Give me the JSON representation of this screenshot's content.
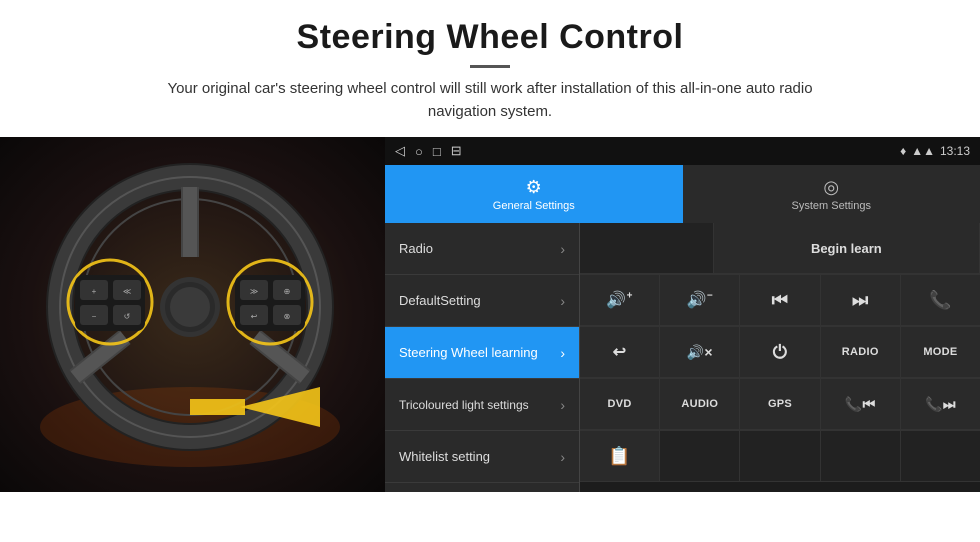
{
  "header": {
    "title": "Steering Wheel Control",
    "subtitle": "Your original car's steering wheel control will still work after installation of this all-in-one auto radio navigation system."
  },
  "status_bar": {
    "back": "◁",
    "home": "○",
    "recent": "□",
    "extra": "⊟",
    "signal": "▾▾",
    "wifi": "▲",
    "time": "13:13"
  },
  "tabs": [
    {
      "id": "general",
      "icon": "⚙",
      "label": "General Settings",
      "active": true
    },
    {
      "id": "system",
      "icon": "◎",
      "label": "System Settings",
      "active": false
    }
  ],
  "menu_items": [
    {
      "label": "Radio",
      "active": false
    },
    {
      "label": "DefaultSetting",
      "active": false
    },
    {
      "label": "Steering Wheel learning",
      "active": true
    },
    {
      "label": "Tricoloured light settings",
      "active": false
    },
    {
      "label": "Whitelist setting",
      "active": false
    }
  ],
  "control_panel": {
    "begin_learn_label": "Begin learn",
    "row1": [
      {
        "label": "",
        "empty": true
      },
      {
        "label": "Begin learn",
        "empty": false
      }
    ],
    "row2": [
      {
        "label": "🔊+",
        "icon": true
      },
      {
        "label": "🔊−",
        "icon": true
      },
      {
        "label": "⏮",
        "icon": true
      },
      {
        "label": "⏭",
        "icon": true
      },
      {
        "label": "📞",
        "icon": true
      }
    ],
    "row3": [
      {
        "label": "↩",
        "icon": true
      },
      {
        "label": "🔊×",
        "icon": true
      },
      {
        "label": "⏻",
        "icon": true
      },
      {
        "label": "RADIO",
        "icon": false
      },
      {
        "label": "MODE",
        "icon": false
      }
    ],
    "row4": [
      {
        "label": "DVD",
        "icon": false
      },
      {
        "label": "AUDIO",
        "icon": false
      },
      {
        "label": "GPS",
        "icon": false
      },
      {
        "label": "📞⏮",
        "icon": true
      },
      {
        "label": "📞⏭",
        "icon": true
      }
    ],
    "row5": [
      {
        "label": "📋",
        "icon": true
      }
    ]
  }
}
